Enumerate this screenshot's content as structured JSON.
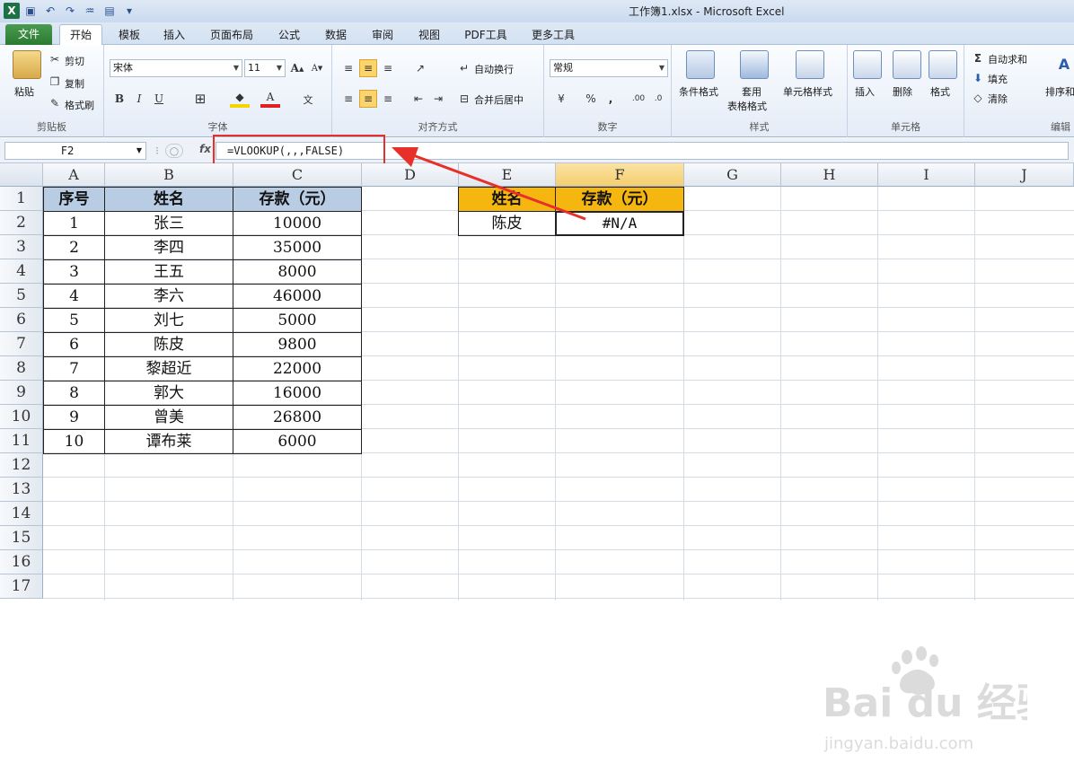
{
  "window": {
    "title": "工作簿1.xlsx - Microsoft Excel"
  },
  "tabs": [
    "文件",
    "开始",
    "模板",
    "插入",
    "页面布局",
    "公式",
    "数据",
    "审阅",
    "视图",
    "PDF工具",
    "更多工具"
  ],
  "ribbon": {
    "clipboard": {
      "label": "剪贴板",
      "paste": "粘贴",
      "cut": "剪切",
      "copy": "复制",
      "format_painter": "格式刷"
    },
    "font": {
      "label": "字体",
      "font_name": "宋体",
      "font_size": "11",
      "bold": "B",
      "italic": "I",
      "underline": "U"
    },
    "alignment": {
      "label": "对齐方式",
      "wrap": "自动换行",
      "merge": "合并后居中"
    },
    "number": {
      "label": "数字",
      "format": "常规",
      "percent": "%",
      "comma": ","
    },
    "styles": {
      "label": "样式",
      "conditional": "条件格式",
      "table_fmt_1": "套用",
      "table_fmt_2": "表格格式",
      "cell_styles": "单元格样式"
    },
    "cells": {
      "label": "单元格",
      "insert": "插入",
      "delete": "删除",
      "format": "格式"
    },
    "editing": {
      "label": "编辑",
      "autosum": "自动求和",
      "fill": "填充",
      "clear": "清除",
      "sort": "排序和"
    }
  },
  "formula_bar": {
    "name_box": "F2",
    "fx": "fx",
    "formula": "=VLOOKUP(,,,FALSE)"
  },
  "columns": [
    "A",
    "B",
    "C",
    "D",
    "E",
    "F",
    "G",
    "H",
    "I",
    "J"
  ],
  "rows": [
    "1",
    "2",
    "3",
    "4",
    "5",
    "6",
    "7",
    "8",
    "9",
    "10",
    "11",
    "12",
    "13",
    "14",
    "15",
    "16",
    "17"
  ],
  "table": {
    "headers": [
      "序号",
      "姓名",
      "存款（元）"
    ],
    "rows": [
      [
        "1",
        "张三",
        "10000"
      ],
      [
        "2",
        "李四",
        "35000"
      ],
      [
        "3",
        "王五",
        "8000"
      ],
      [
        "4",
        "李六",
        "46000"
      ],
      [
        "5",
        "刘七",
        "5000"
      ],
      [
        "6",
        "陈皮",
        "9800"
      ],
      [
        "7",
        "黎超近",
        "22000"
      ],
      [
        "8",
        "郭大",
        "16000"
      ],
      [
        "9",
        "曾美",
        "26800"
      ],
      [
        "10",
        "谭布莱",
        "6000"
      ]
    ]
  },
  "lookup": {
    "headers": [
      "姓名",
      "存款（元）"
    ],
    "name": "陈皮",
    "result": "#N/A"
  },
  "watermark": {
    "brand": "Bai du 经验",
    "url": "jingyan.baidu.com"
  },
  "colors": {
    "header_blue": "#b8cce4",
    "header_gold": "#f5b70f",
    "annotation_red": "#e8302a",
    "file_tab_green": "#2a7a32"
  }
}
